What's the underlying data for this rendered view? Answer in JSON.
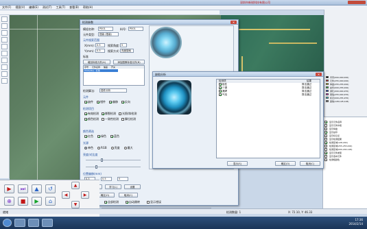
{
  "menu": [
    "文件(F)",
    "视图(V)",
    "编辑(E)",
    "测试(T)",
    "工具(T)",
    "查看(B)",
    "帮助(H)"
  ],
  "main_dialog": {
    "title": "检测参数",
    "model_label": "模组名称:",
    "model_value": "P001",
    "part_label": "料号:",
    "part_value": "P001",
    "pcb_label": "元件类型:",
    "pcb_value": "插装 (插装)",
    "search_group": "元件搜索范围",
    "x_label": "X(mm):",
    "x_value": "0.5",
    "y_label": "Y(mm):",
    "y_value": "0.5",
    "angle_label": "搜索角度:",
    "angle_value": "5",
    "search_method_label": "搜索方式:",
    "search_method_value": "亮度搜索",
    "std_label": "标准",
    "add_std_button": "增加标准元件(A)",
    "add_img_button": "添加图像标准元件(B)",
    "list_columns": [
      "序号",
      "元件名称",
      "偏差",
      "开关"
    ],
    "list_row": "P001[Ba] - 标准",
    "check_method_label": "检测算法:",
    "check_method_value": "插件分析",
    "status_group": "元件",
    "status_items": [
      "缺件",
      "错件",
      "偏移",
      "反向"
    ],
    "detect_group": "检测项目",
    "detect_items": [
      "有效检测",
      "撕裂检测",
      "光照/斜检测",
      "颜色检测",
      "一致性检测",
      "脚位检测"
    ],
    "color_group": "颜色筛选",
    "color_items": [
      "红色",
      "绿色",
      "蓝色"
    ],
    "light_group": "光源",
    "light_items": [
      "单色",
      "RGB",
      "亮度",
      "最大"
    ],
    "threshold_label": "亮度/对比度",
    "offset_label": "位置偏移(mm)",
    "offset_values": {
      "dx": "0.5",
      "dy": "0.5",
      "dr": "5"
    },
    "detect_button": "检测分析(D)",
    "learn_button": "学习(L)",
    "apply_button": "设置",
    "ok_button": "确定(O)",
    "cancel_button": "取消(C)"
  },
  "analysis_dialog": {
    "title": "缺陷分析",
    "columns": [
      "检测项",
      "结果"
    ],
    "rows": [
      {
        "name": "极性",
        "result": "算法通过"
      },
      {
        "name": "少锡",
        "result": "算法通过"
      },
      {
        "name": "漏焊",
        "result": "算法通过"
      },
      {
        "name": "气泡",
        "result": "算法通过"
      }
    ],
    "left_button": "显示(S)",
    "ok_button": "确定(O)",
    "cancel_button": "取消(C)"
  },
  "right_panel": {
    "items": [
      {
        "label": "背景(000,000,000)",
        "color": "#000000"
      },
      {
        "label": "元件(255,000,000)",
        "color": "#d12b2b"
      },
      {
        "label": "焊盘(255,255,000)",
        "color": "#e0d22a"
      },
      {
        "label": "丝印(000,255,000)",
        "color": "#2cc63a"
      },
      {
        "label": "通孔(000,000,255)",
        "color": "#2a46d8"
      },
      {
        "label": "铜箔(255,000,255)",
        "color": "#d82ad0"
      },
      {
        "label": "标记(000,255,255)",
        "color": "#2ad6d8"
      },
      {
        "label": "其他(128,128,128)",
        "color": "#808080"
      }
    ],
    "bottom_items": [
      "显示元件名称",
      "显示元件外框",
      "显示焊盘",
      "显示丝印",
      "显示标记点",
      "显示检测结果",
      "检测区域(128,200)",
      "检测区域(255,255,000)",
      "检测区域(000,200,128)",
      "显示元件类型",
      "显示选中元件",
      "检测框颜色"
    ]
  },
  "bottom_checks": [
    "全部检测",
    "自动跳转",
    "显示错误"
  ],
  "status_bar": {
    "left": "就绪",
    "middle": "检测数量: 1",
    "right": "X: 72.10, Y: 46.33"
  },
  "taskbar": {
    "time": "17:36",
    "date": "2014/2/14"
  },
  "progress": {
    "value": 1.0,
    "color": "#23c12e"
  },
  "header_text": "深圳市新锐科技有限公司"
}
